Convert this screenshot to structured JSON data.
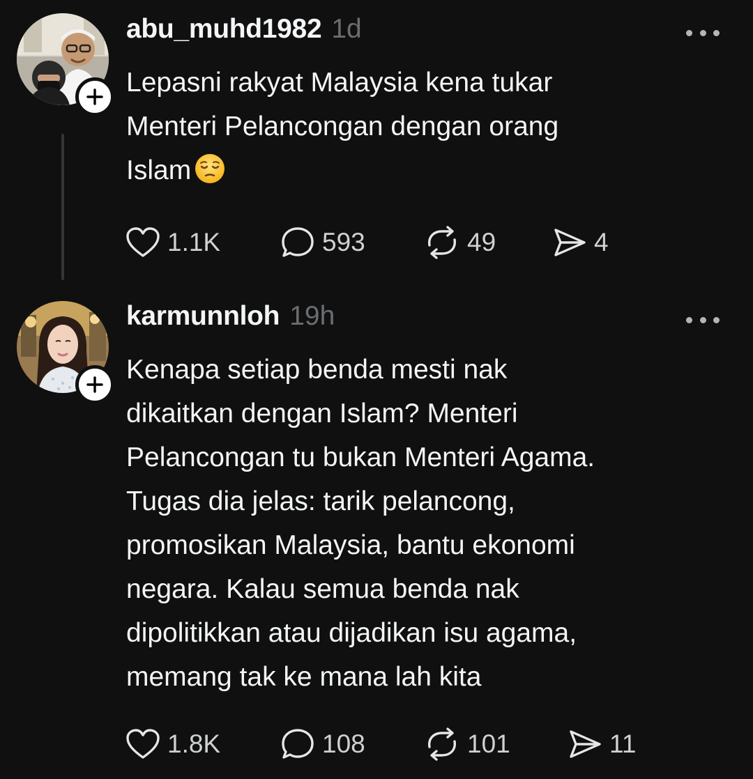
{
  "posts": [
    {
      "username": "abu_muhd1982",
      "time": "1d",
      "text": "Lepasni rakyat Malaysia kena tukar\nMenteri Pelancongan dengan orang\nIslam",
      "emoji": "pensive-face",
      "likes": "1.1K",
      "replies": "593",
      "reposts": "49",
      "shares": "4"
    },
    {
      "username": "karmunnloh",
      "time": "19h",
      "text": "Kenapa setiap benda mesti nak\ndikaitkan dengan Islam? Menteri\nPelancongan tu bukan Menteri Agama.\nTugas dia jelas: tarik pelancong,\npromosikan Malaysia, bantu ekonomi\nnegara. Kalau semua benda nak\ndipolitikkan atau dijadikan isu agama,\nmemang tak ke mana lah kita",
      "likes": "1.8K",
      "replies": "108",
      "reposts": "101",
      "shares": "11"
    }
  ],
  "icons": {
    "like": "heart-icon",
    "reply": "comment-bubble-icon",
    "repost": "repost-arrows-icon",
    "share": "send-icon",
    "more": "more-options-icon",
    "follow": "plus-icon"
  },
  "colors": {
    "background": "#101010",
    "text": "#f3f5f7",
    "secondary": "#6b6e71",
    "thread_line": "#333638"
  }
}
